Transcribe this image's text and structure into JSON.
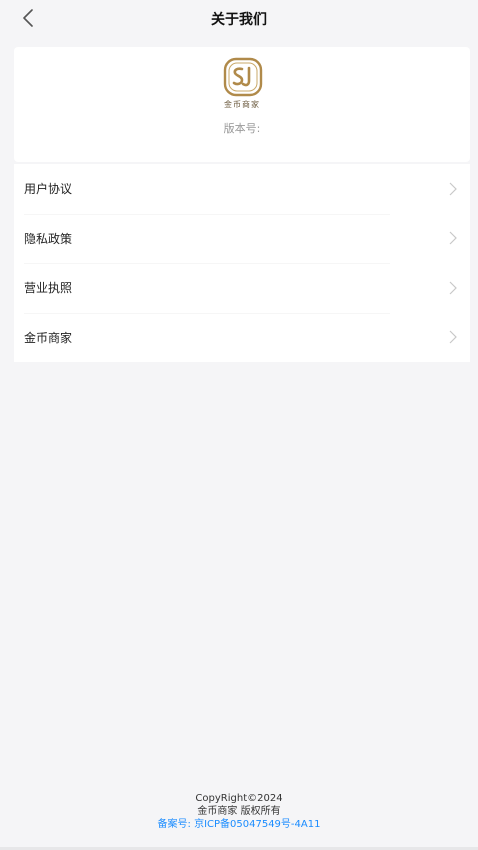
{
  "nav": {
    "title": "关于我们"
  },
  "about": {
    "logo_text": "金币商家",
    "version_label": "版本号:"
  },
  "menu": {
    "items": [
      {
        "label": "用户协议"
      },
      {
        "label": "隐私政策"
      },
      {
        "label": "营业执照"
      },
      {
        "label": "金币商家"
      }
    ]
  },
  "footer": {
    "copyright": "CopyRight©2024",
    "rights": "金币商家 版权所有",
    "icp": "备案号: 京ICP备05047549号-4A11"
  },
  "colors": {
    "accent_gold": "#b08a4a",
    "link_blue": "#1a8cff",
    "background": "#f5f5f7"
  }
}
